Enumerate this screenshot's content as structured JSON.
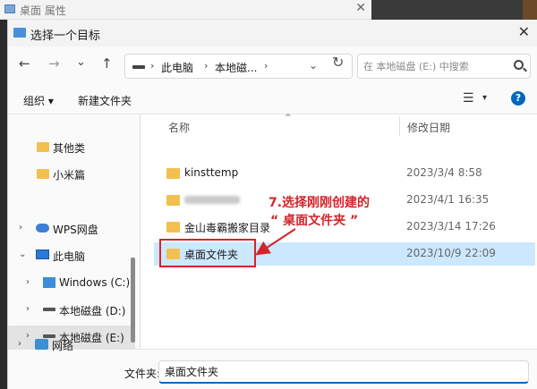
{
  "background_window": {
    "title": "桌面 属性",
    "close": "✕"
  },
  "dialog": {
    "title": "选择一个目标",
    "close": "✕"
  },
  "nav": {
    "back": "←",
    "forward": "→",
    "recent": "⌄",
    "up": "↑",
    "refresh": "↻",
    "breadcrumb": [
      "此电脑",
      "本地磁..."
    ],
    "chevron": "›",
    "dropdown": "⌄",
    "search_placeholder": "在 本地磁盘 (E:) 中搜索"
  },
  "commandbar": {
    "organize": "组织 ▾",
    "new_folder": "新建文件夹",
    "view": "☰",
    "view_dd": "▾",
    "help": "?"
  },
  "sidebar": {
    "items": [
      {
        "label": "其他类",
        "icon": "folder-icon"
      },
      {
        "label": "小米篇",
        "icon": "folder-icon"
      },
      {
        "label": "WPS网盘",
        "icon": "cloud-icon",
        "expander": "›"
      },
      {
        "label": "此电脑",
        "icon": "computer-icon",
        "expander": "⌄"
      },
      {
        "label": "Windows  (C:)",
        "icon": "windows-drive-icon",
        "expander": "›"
      },
      {
        "label": "本地磁盘 (D:)",
        "icon": "drive-icon",
        "expander": "›"
      },
      {
        "label": "本地磁盘 (E:)",
        "icon": "drive-icon",
        "expander": "›"
      },
      {
        "label": "网络",
        "icon": "network-icon",
        "expander": "›"
      }
    ]
  },
  "columns": {
    "name": "名称",
    "modified": "修改日期",
    "sort": "^"
  },
  "files": [
    {
      "name": "kinsttemp",
      "date": "2023/3/4 8:58"
    },
    {
      "name": "",
      "date": "2023/4/1 16:35",
      "blurred": true
    },
    {
      "name": "金山毒霸搬家目录",
      "date": "2023/3/14 17:26"
    },
    {
      "name": "桌面文件夹",
      "date": "2023/10/9 22:09",
      "selected": true
    }
  ],
  "annotation": {
    "line1": "7.选择刚刚创建的",
    "line2": "“  桌面文件夹  ”"
  },
  "footer": {
    "label": "文件夹:",
    "value": "桌面文件夹"
  },
  "colors": {
    "accent": "#0067c0",
    "annotation": "#d4242a",
    "selection": "#cce8ff",
    "folder": "#f2c04f"
  }
}
